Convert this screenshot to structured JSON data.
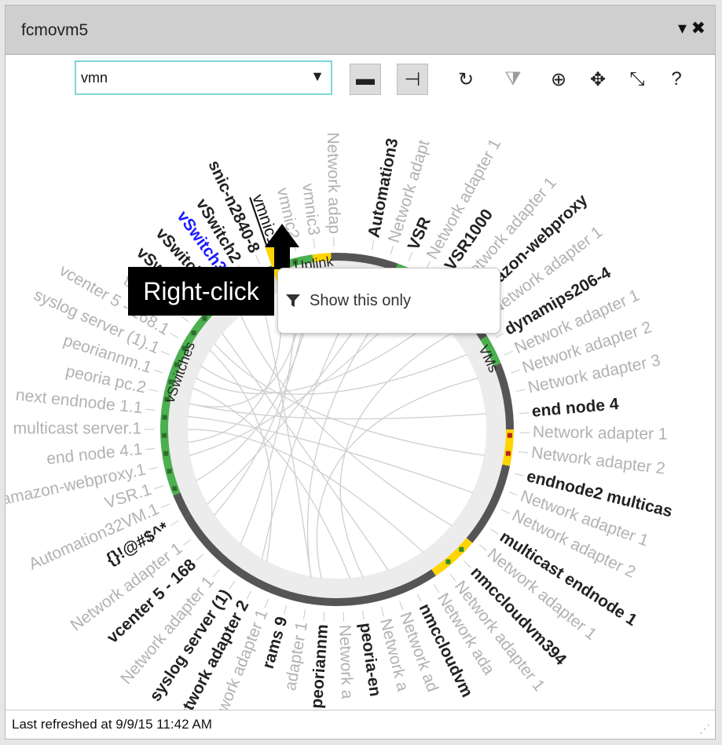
{
  "window": {
    "title": "fcmovm5",
    "menu_glyph": "▾",
    "close_glyph": "✖"
  },
  "toolbar": {
    "search_value": "vmn",
    "dropdown_glyph": "▼",
    "tools": [
      {
        "name": "comment-icon",
        "glyph": "▬",
        "pressed": true,
        "grey": false
      },
      {
        "name": "plug-icon",
        "glyph": "⊣",
        "pressed": true,
        "grey": false
      },
      {
        "name": "refresh-icon",
        "glyph": "↻",
        "pressed": false,
        "grey": false
      },
      {
        "name": "filter-undo-icon",
        "glyph": "⧩",
        "pressed": false,
        "grey": true
      },
      {
        "name": "add-circle-icon",
        "glyph": "⊕",
        "pressed": false,
        "grey": false
      },
      {
        "name": "move-icon",
        "glyph": "✥",
        "pressed": false,
        "grey": false
      },
      {
        "name": "collapse-icon",
        "glyph": "⤡",
        "pressed": false,
        "grey": false
      },
      {
        "name": "help-icon",
        "glyph": "?",
        "pressed": false,
        "grey": false
      }
    ]
  },
  "callout": {
    "text": "Right-click"
  },
  "context_menu": {
    "items": [
      "Show this only"
    ]
  },
  "ring": {
    "group_labels": [
      "vSwitches",
      "VMs",
      "Uplink"
    ],
    "colors": {
      "vswitch": "#4caf50",
      "vm": "#555555",
      "highlight": "#ffd400",
      "alarm": "#b22222",
      "ring_bg": "#ececec"
    }
  },
  "labels": [
    {
      "text": "Automation3",
      "angle": -79,
      "style": "dark"
    },
    {
      "text": "Network adapt",
      "angle": -73,
      "style": "light"
    },
    {
      "text": "VSR",
      "angle": -67,
      "style": "dark"
    },
    {
      "text": "Network adapter 1",
      "angle": -61,
      "style": "light"
    },
    {
      "text": "VSR1000",
      "angle": -55,
      "style": "dark"
    },
    {
      "text": "Network adapter 1",
      "angle": -49,
      "style": "light"
    },
    {
      "text": "amazon-webproxy",
      "angle": -43,
      "style": "dark"
    },
    {
      "text": "Network adapter 1",
      "angle": -37,
      "style": "light"
    },
    {
      "text": "dynamips206-4",
      "angle": -30,
      "style": "dark"
    },
    {
      "text": "Network adapter 1",
      "angle": -24,
      "style": "light"
    },
    {
      "text": "Network adapter 2",
      "angle": -18,
      "style": "light"
    },
    {
      "text": "Network adapter 3",
      "angle": -12,
      "style": "light"
    },
    {
      "text": "end node 4",
      "angle": -5,
      "style": "dark"
    },
    {
      "text": "Network adapter 1",
      "angle": 1,
      "style": "light"
    },
    {
      "text": "Network adapter 2",
      "angle": 7,
      "style": "light"
    },
    {
      "text": "endnode2 multicas",
      "angle": 14,
      "style": "dark"
    },
    {
      "text": "Network adapter 1",
      "angle": 20,
      "style": "light"
    },
    {
      "text": "Network adapter 2",
      "angle": 26,
      "style": "light"
    },
    {
      "text": "multicast endnode 1",
      "angle": 33,
      "style": "dark"
    },
    {
      "text": "Network adapter 1",
      "angle": 39,
      "style": "light"
    },
    {
      "text": "nmccloudvm394",
      "angle": 46,
      "style": "dark"
    },
    {
      "text": "Network adapter 1",
      "angle": 52,
      "style": "light"
    },
    {
      "text": "Network ada",
      "angle": 58,
      "style": "light"
    },
    {
      "text": "nmccloudvm",
      "angle": 64,
      "style": "dark"
    },
    {
      "text": "Network ad",
      "angle": 70,
      "style": "light"
    },
    {
      "text": "Network a",
      "angle": 76,
      "style": "light"
    },
    {
      "text": "peoria-en",
      "angle": 82,
      "style": "dark"
    },
    {
      "text": "Network a",
      "angle": 88,
      "style": "light"
    },
    {
      "text": "peoriannm",
      "angle": 94,
      "style": "dark"
    },
    {
      "text": "adapter 1",
      "angle": 100,
      "style": "light"
    },
    {
      "text": "rams 9",
      "angle": 106,
      "style": "dark"
    },
    {
      "text": "Network adapter 1",
      "angle": 112,
      "style": "light"
    },
    {
      "text": "Network adapter 2",
      "angle": 118,
      "style": "dark"
    },
    {
      "text": "syslog server (1)",
      "angle": 124,
      "style": "dark"
    },
    {
      "text": "Network adapter 1",
      "angle": 130,
      "style": "light"
    },
    {
      "text": "vcenter 5 - 168",
      "angle": 137,
      "style": "dark"
    },
    {
      "text": "Network adapter 1",
      "angle": 143,
      "style": "light"
    },
    {
      "text": "{}!@#$^*",
      "angle": 150,
      "style": "dark"
    },
    {
      "text": "Automation32VM.1",
      "angle": 156,
      "style": "light"
    },
    {
      "text": "VSR.1",
      "angle": 162,
      "style": "light"
    },
    {
      "text": "amazon-webproxy.1",
      "angle": 168,
      "style": "light"
    },
    {
      "text": "end node 4.1",
      "angle": 174,
      "style": "light"
    },
    {
      "text": "multicast server.1",
      "angle": 180,
      "style": "light"
    },
    {
      "text": "next endnode 1.1",
      "angle": 186,
      "style": "light"
    },
    {
      "text": "peoria pc.2",
      "angle": 192,
      "style": "light"
    },
    {
      "text": "peoriannm.1",
      "angle": 198,
      "style": "light"
    },
    {
      "text": "syslog server (1).1",
      "angle": 204,
      "style": "light"
    },
    {
      "text": "vcenter 5 - 168.1",
      "angle": 210,
      "style": "light"
    },
    {
      "text": "{}!@#$^*",
      "angle": 216,
      "style": "light"
    },
    {
      "text": "vSwitch1",
      "angle": 222,
      "style": "dark"
    },
    {
      "text": "vSwitch2",
      "angle": 228,
      "style": "dark"
    },
    {
      "text": "vSwitch3",
      "angle": 234,
      "style": "blue"
    },
    {
      "text": "vSwitch2",
      "angle": 239,
      "style": "dark"
    },
    {
      "text": "snic-n2840-8",
      "angle": 245,
      "style": "dark"
    },
    {
      "text": "vmnic1",
      "angle": 251,
      "style": "highlight"
    },
    {
      "text": "vmnic2",
      "angle": 257,
      "style": "light"
    },
    {
      "text": "vmnic3",
      "angle": 263,
      "style": "light"
    },
    {
      "text": "Network adap",
      "angle": 269,
      "style": "light"
    }
  ],
  "status": {
    "text": "Last refreshed at 9/9/15 11:42 AM",
    "grip": "⋰"
  }
}
